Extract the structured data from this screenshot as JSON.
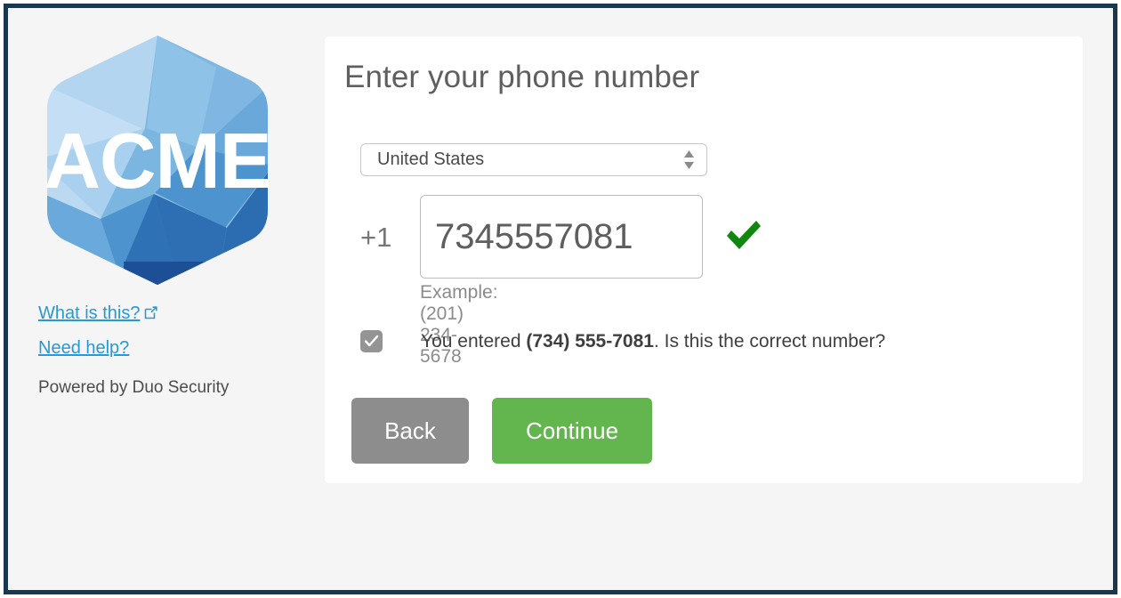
{
  "frame": {
    "border_color": "#17384f",
    "page_background": "#f5f5f5"
  },
  "brand": {
    "logo_text": "ACME",
    "logo_alt": "acme-hexagon-logo",
    "links": [
      {
        "label": "What is this?",
        "icon": "external-link-icon",
        "has_external_icon": true
      },
      {
        "label": "Need help?",
        "icon": "",
        "has_external_icon": false
      }
    ],
    "powered_by": "Powered by Duo Security",
    "link_color": "#2699d6"
  },
  "card": {
    "title": "Enter your phone number",
    "country_select": {
      "selected": "United States",
      "options": [
        "United States"
      ],
      "icon": "stepper-updown-icon"
    },
    "phone": {
      "country_code": "+1",
      "value": "7345557081",
      "placeholder": "",
      "example_hint": "Example: (201) 234-5678",
      "validated": true,
      "check_icon": "green-check-icon",
      "check_color": "#128710"
    },
    "confirm": {
      "checked": true,
      "checkbox_icon": "checkbox-checked-icon",
      "text_before": "You entered ",
      "formatted_number": "(734) 555-7081",
      "text_after": ". Is this the correct number?"
    },
    "buttons": {
      "back_label": "Back",
      "back_color": "#8d8d8d",
      "continue_label": "Continue",
      "continue_color": "#63b64d"
    }
  }
}
